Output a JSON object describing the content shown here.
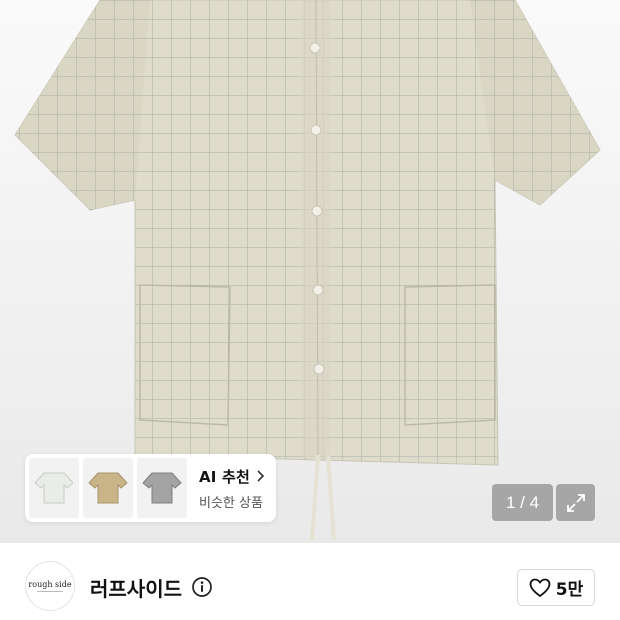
{
  "product_image": {
    "pager_text": "1 / 4",
    "expand_icon": "expand-diagonal-icon"
  },
  "ai_recommend": {
    "title": "AI 추천",
    "subtitle": "비슷한 상품",
    "chevron_icon": "chevron-right-icon",
    "thumbnails": [
      {
        "color": "#e9ece7"
      },
      {
        "color": "#c9b487"
      },
      {
        "color": "#a3a3a3"
      }
    ]
  },
  "brand": {
    "logo_text": "rough side",
    "name": "러프사이드",
    "info_icon": "info-circle-icon",
    "like_icon": "heart-outline-icon",
    "like_count": "5만"
  },
  "colors": {
    "shirt": "#dfdccb",
    "grid": "#8e9a9a",
    "overlay": "#6e6e6e"
  }
}
